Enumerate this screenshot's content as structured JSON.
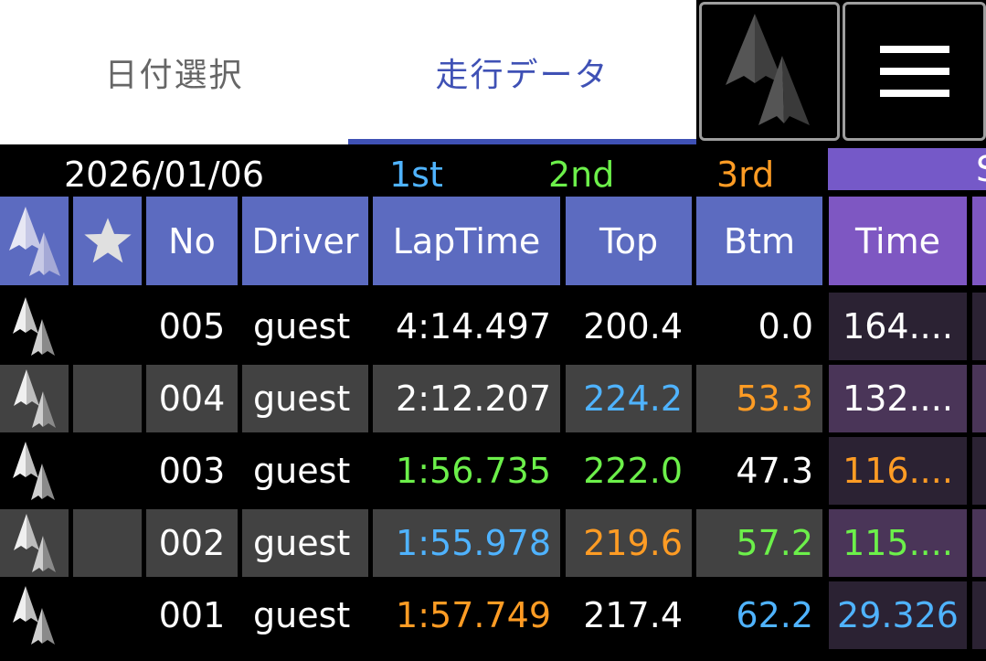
{
  "tabs": [
    {
      "label": "日付選択",
      "selected": false
    },
    {
      "label": "走行データ",
      "selected": true
    }
  ],
  "icons": {
    "logo": "app-logo-icon",
    "menu": "hamburger-menu-icon",
    "star": "star-icon"
  },
  "info": {
    "date": "2026/01/06",
    "first": "1st",
    "second": "2nd",
    "third": "3rd",
    "sec_label": "S"
  },
  "header": {
    "no": "No",
    "driver": "Driver",
    "laptime": "LapTime",
    "top": "Top",
    "btm": "Btm",
    "time": "Time"
  },
  "colors": {
    "first": "#4fb3ff",
    "second": "#6cf04a",
    "third": "#ff9c24",
    "header": "#5c6bc0",
    "header_sector": "#7e57c2",
    "accent": "#3f51b5"
  },
  "rows": [
    {
      "no": "005",
      "driver": "guest",
      "laptime": "4:14.497",
      "top": "200.4",
      "btm": "0.0",
      "time": "164....",
      "laptime_color": "white",
      "top_color": "white",
      "btm_color": "white",
      "time_color": "white"
    },
    {
      "no": "004",
      "driver": "guest",
      "laptime": "2:12.207",
      "top": "224.2",
      "btm": "53.3",
      "time": "132....",
      "laptime_color": "white",
      "top_color": "blue",
      "btm_color": "orange",
      "time_color": "white"
    },
    {
      "no": "003",
      "driver": "guest",
      "laptime": "1:56.735",
      "top": "222.0",
      "btm": "47.3",
      "time": "116....",
      "laptime_color": "green",
      "top_color": "green",
      "btm_color": "white",
      "time_color": "orange"
    },
    {
      "no": "002",
      "driver": "guest",
      "laptime": "1:55.978",
      "top": "219.6",
      "btm": "57.2",
      "time": "115....",
      "laptime_color": "blue",
      "top_color": "orange",
      "btm_color": "green",
      "time_color": "green"
    },
    {
      "no": "001",
      "driver": "guest",
      "laptime": "1:57.749",
      "top": "217.4",
      "btm": "62.2",
      "time": "29.326",
      "laptime_color": "orange",
      "top_color": "white",
      "btm_color": "blue",
      "time_color": "blue"
    }
  ]
}
